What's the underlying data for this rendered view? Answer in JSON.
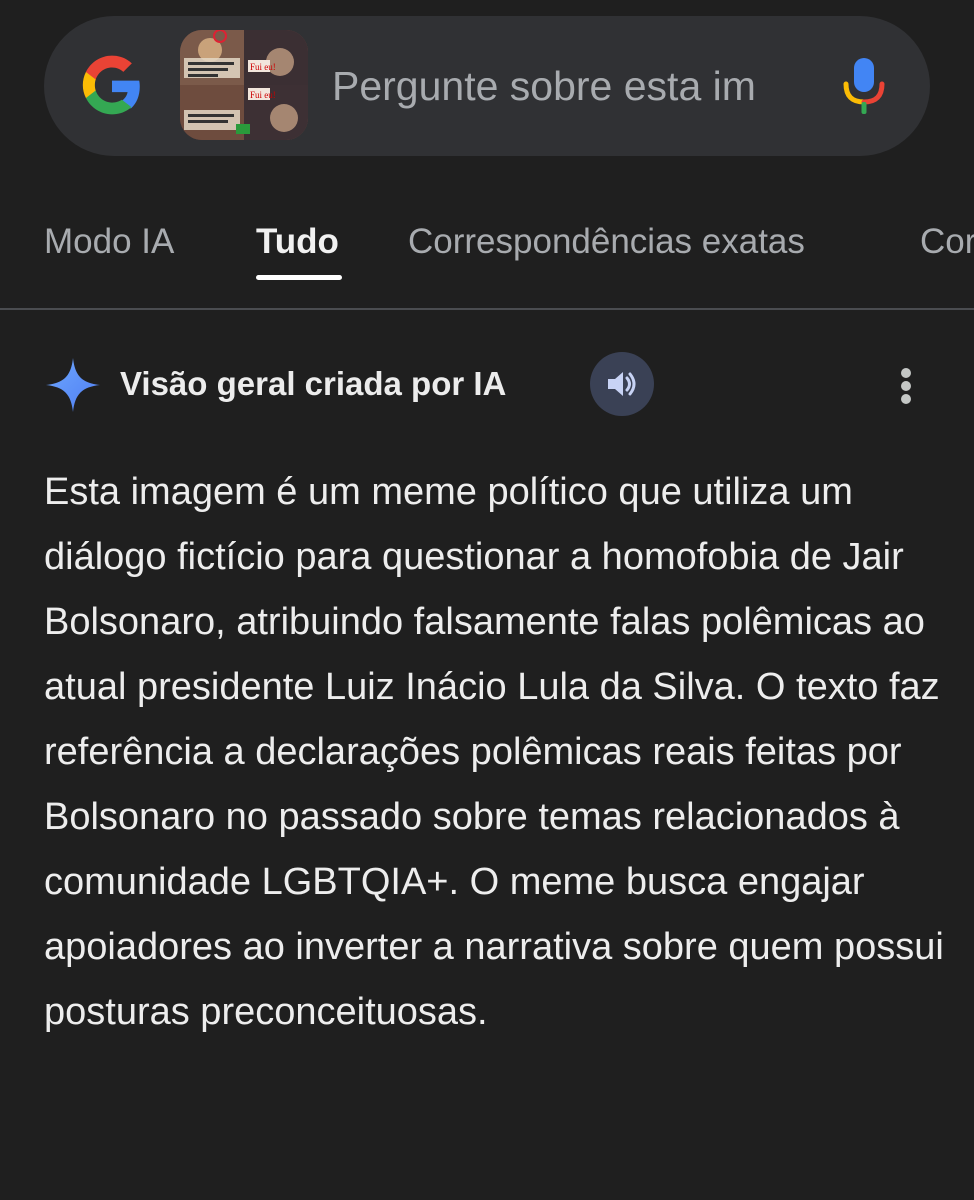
{
  "search": {
    "placeholder": "Pergunte sobre esta im",
    "thumbnail": {
      "texts": [
        "Fui eu!",
        "Fui eu!"
      ]
    }
  },
  "tabs": [
    {
      "label": "Modo IA",
      "active": false
    },
    {
      "label": "Tudo",
      "active": true
    },
    {
      "label": "Correspondências exatas",
      "active": false
    },
    {
      "label": "Cor",
      "active": false
    }
  ],
  "ai_overview": {
    "title": "Visão geral criada por IA",
    "body": "Esta imagem é um meme político que utiliza um diálogo fictício para questionar a homofobia de Jair Bolsonaro, atribuindo falsamente falas polêmicas ao atual presidente Luiz Inácio Lula da Silva. O texto faz referência a declarações polêmicas reais feitas por Bolsonaro no passado sobre temas relacionados à comunidade LGBTQIA+. O meme busca engajar apoiadores ao inverter a narrativa sobre quem possui posturas preconceituosas."
  },
  "colors": {
    "background": "#1f1f1f",
    "search_bar": "#303134",
    "sparkle_blue": "#5b8df7",
    "speaker_bg": "#3a4155"
  },
  "icons": [
    "google-logo-icon",
    "microphone-icon",
    "sparkle-icon",
    "speaker-icon",
    "more-vert-icon"
  ]
}
